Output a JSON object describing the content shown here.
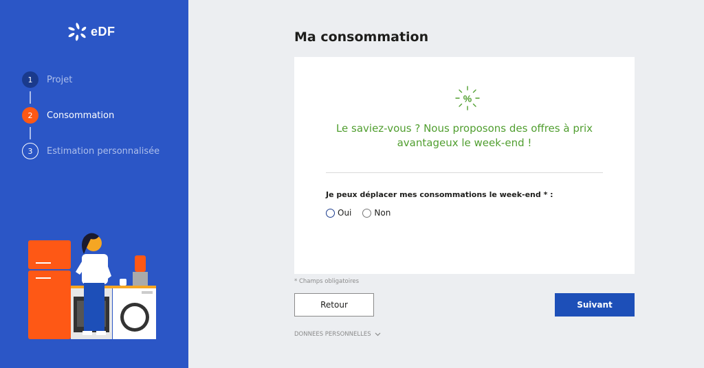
{
  "brand": {
    "logo_text": "eDF"
  },
  "steps": [
    {
      "number": "1",
      "label": "Projet",
      "state": "done"
    },
    {
      "number": "2",
      "label": "Consommation",
      "state": "active"
    },
    {
      "number": "3",
      "label": "Estimation personnalisée",
      "state": "todo"
    }
  ],
  "page": {
    "title": "Ma consommation"
  },
  "tip": {
    "icon": "percent-sparkle-icon",
    "text": "Le saviez-vous ? Nous proposons des offres à prix avantageux le week-end !"
  },
  "question": {
    "label": "Je peux déplacer mes consommations le week-end * :",
    "options": [
      "Oui",
      "Non"
    ],
    "selected": null
  },
  "required_note": "* Champs obligatoires",
  "buttons": {
    "back_label": "Retour",
    "next_label": "Suivant"
  },
  "footer": {
    "personal_data_label": "DONNEES PERSONNELLES"
  },
  "colors": {
    "sidebar": "#2b56c6",
    "accent_orange": "#fe5815",
    "primary_button": "#1d4fb8",
    "tip_green": "#509e2f",
    "background": "#eceef1"
  }
}
